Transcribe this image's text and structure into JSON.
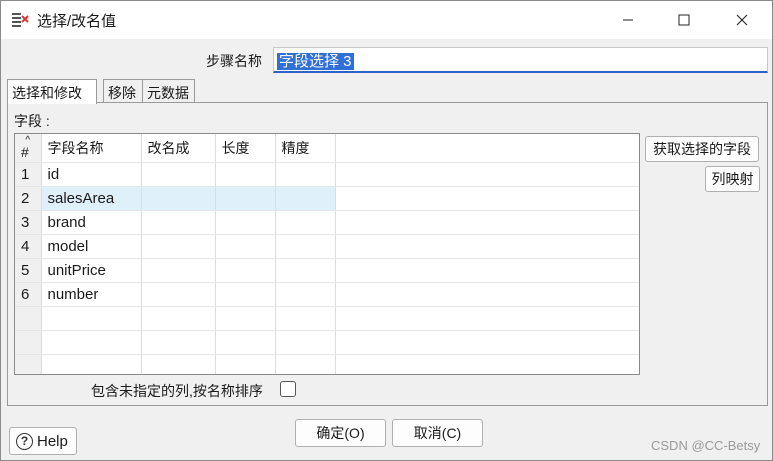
{
  "window": {
    "title": "选择/改名值",
    "icons": {
      "app": "select-rename-icon",
      "minimize": "minimize-icon",
      "maximize": "maximize-icon",
      "close": "close-icon"
    }
  },
  "step": {
    "label": "步骤名称",
    "value": "字段选择 3"
  },
  "tabs": [
    {
      "label": "选择和修改",
      "active": true
    },
    {
      "label": "移除",
      "active": false
    },
    {
      "label": "元数据",
      "active": false
    }
  ],
  "fields": {
    "label": "字段 :",
    "columns": [
      "#",
      "字段名称",
      "改名成",
      "长度",
      "精度"
    ],
    "rows": [
      {
        "num": "1",
        "name": "id",
        "rename": "",
        "length": "",
        "precision": ""
      },
      {
        "num": "2",
        "name": "salesArea",
        "rename": "",
        "length": "",
        "precision": ""
      },
      {
        "num": "3",
        "name": "brand",
        "rename": "",
        "length": "",
        "precision": ""
      },
      {
        "num": "4",
        "name": "model",
        "rename": "",
        "length": "",
        "precision": ""
      },
      {
        "num": "5",
        "name": "unitPrice",
        "rename": "",
        "length": "",
        "precision": ""
      },
      {
        "num": "6",
        "name": "number",
        "rename": "",
        "length": "",
        "precision": ""
      }
    ],
    "selected_row": 2
  },
  "buttons": {
    "get_fields": "获取选择的字段",
    "mapping": "列映射",
    "ok": "确定(O)",
    "cancel": "取消(C)",
    "help": "Help"
  },
  "include_unspecified": {
    "label": "包含未指定的列,按名称排序",
    "checked": false
  },
  "watermark": "CSDN @CC-Betsy",
  "colors": {
    "selection": "#2f6fd6",
    "row_highlight": "#dff0fb",
    "focus_underline": "#2b63c6"
  }
}
